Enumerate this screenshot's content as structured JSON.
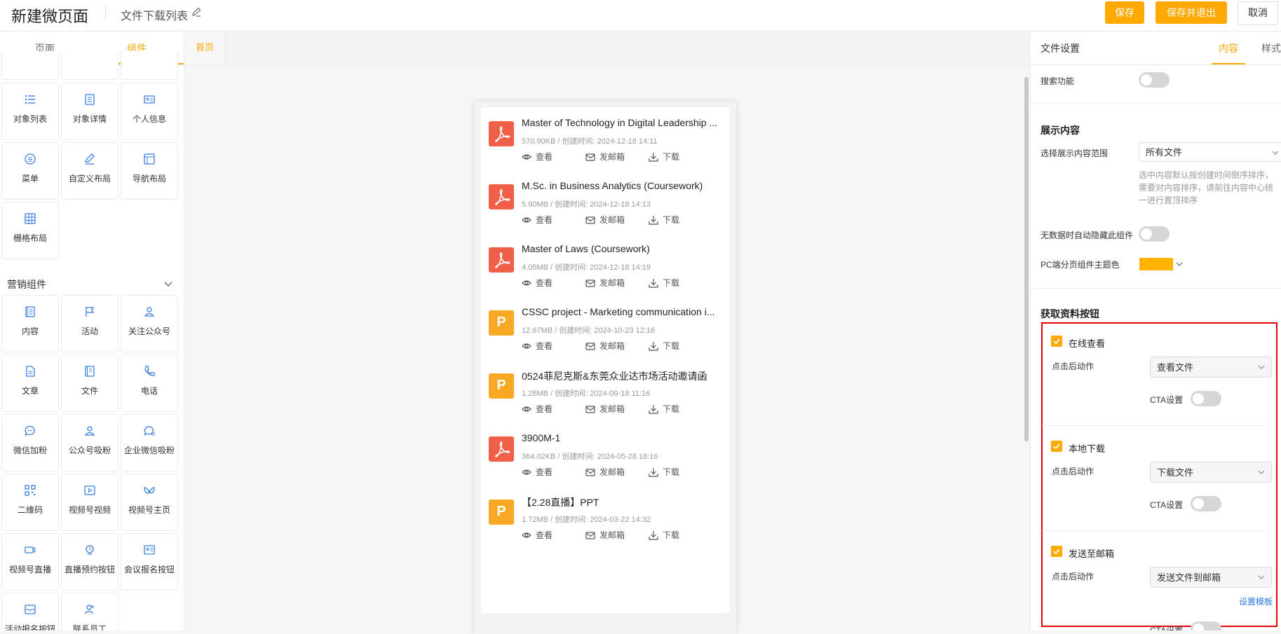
{
  "header": {
    "app_title": "新建微页面",
    "page_name": "文件下载列表",
    "save_label": "保存",
    "save_exit_label": "保存并退出",
    "cancel_label": "取消"
  },
  "left_panel": {
    "tabs": [
      "页面",
      "组件"
    ],
    "active_tab": "组件",
    "basic_components": [
      {
        "label": "对象列表",
        "icon": "list-icon"
      },
      {
        "label": "对象详情",
        "icon": "detail-icon"
      },
      {
        "label": "个人信息",
        "icon": "id-card-icon"
      },
      {
        "label": "菜单",
        "icon": "menu-circle-icon"
      },
      {
        "label": "自定义布局",
        "icon": "pen-icon"
      },
      {
        "label": "导航布局",
        "icon": "nav-layout-icon"
      },
      {
        "label": "栅格布局",
        "icon": "grid-icon"
      }
    ],
    "marketing_section_title": "营销组件",
    "marketing_components": [
      {
        "label": "内容",
        "icon": "content-icon"
      },
      {
        "label": "活动",
        "icon": "flag-icon"
      },
      {
        "label": "关注公众号",
        "icon": "follow-icon"
      },
      {
        "label": "文章",
        "icon": "article-icon"
      },
      {
        "label": "文件",
        "icon": "file-icon"
      },
      {
        "label": "电话",
        "icon": "phone-icon"
      },
      {
        "label": "微信加粉",
        "icon": "wechat-icon"
      },
      {
        "label": "公众号吸粉",
        "icon": "user-icon"
      },
      {
        "label": "企业微信吸粉",
        "icon": "wecom-icon"
      },
      {
        "label": "二维码",
        "icon": "qrcode-icon"
      },
      {
        "label": "视频号视频",
        "icon": "video-icon"
      },
      {
        "label": "视频号主页",
        "icon": "channel-icon"
      },
      {
        "label": "视频号直播",
        "icon": "live-icon"
      },
      {
        "label": "直播预约按钮",
        "icon": "reserve-icon"
      },
      {
        "label": "会议报名按钮",
        "icon": "meeting-icon"
      },
      {
        "label": "活动报名按钮",
        "icon": "signup-icon"
      },
      {
        "label": "联系员工",
        "icon": "contact-icon"
      }
    ]
  },
  "canvas": {
    "tab_label": "首页",
    "files": [
      {
        "title": "Master of Technology in Digital Leadership ...",
        "meta": "570.90KB / 创建时间:  2024-12-18 14:11",
        "type": "pdf"
      },
      {
        "title": "M.Sc. in Business Analytics (Coursework)",
        "meta": "5.90MB / 创建时间:  2024-12-18 14:13",
        "type": "pdf"
      },
      {
        "title": "Master of Laws (Coursework)",
        "meta": "4.05MB / 创建时间:  2024-12-18 14:19",
        "type": "pdf"
      },
      {
        "title": "CSSC project - Marketing communication i...",
        "meta": "12.67MB / 创建时间:  2024-10-23 12:16",
        "type": "ppt"
      },
      {
        "title": "0524菲尼克斯&东莞众业达市场活动邀请函",
        "meta": "1.28MB / 创建时间:  2024-09-18 11:16",
        "type": "ppt"
      },
      {
        "title": "3900M-1",
        "meta": "364.02KB / 创建时间:  2024-05-28 16:16",
        "type": "pdf"
      },
      {
        "title": "【2.28直播】PPT",
        "meta": "1.72MB / 创建时间:  2024-03-22 14:32",
        "type": "ppt"
      }
    ],
    "actions": {
      "view": "查看",
      "email": "发邮箱",
      "download": "下载"
    },
    "ppt_letter": "P"
  },
  "right_panel": {
    "title": "文件设置",
    "tabs": [
      "内容",
      "样式"
    ],
    "active_tab": "内容",
    "search_label": "搜索功能",
    "display_section": "展示内容",
    "range_label": "选择展示内容范围",
    "range_value": "所有文件",
    "range_hint": "选中内容默认按创建时间倒序排序，需要对内容排序，请前往内容中心统一进行置顶排序",
    "autohide_label": "无数据时自动隐藏此组件",
    "theme_label": "PC端分页组件主题色",
    "theme_color": "#ffb300",
    "button_section": "获取资料按钮",
    "options": [
      {
        "label": "在线查看",
        "action_label": "点击后动作",
        "action_value": "查看文件",
        "cta_label": "CTA设置"
      },
      {
        "label": "本地下载",
        "action_label": "点击后动作",
        "action_value": "下载文件",
        "cta_label": "CTA设置"
      },
      {
        "label": "发送至邮箱",
        "action_label": "点击后动作",
        "action_value": "发送文件到邮箱",
        "cta_label": "CTA设置",
        "template_link": "设置模板"
      }
    ]
  }
}
